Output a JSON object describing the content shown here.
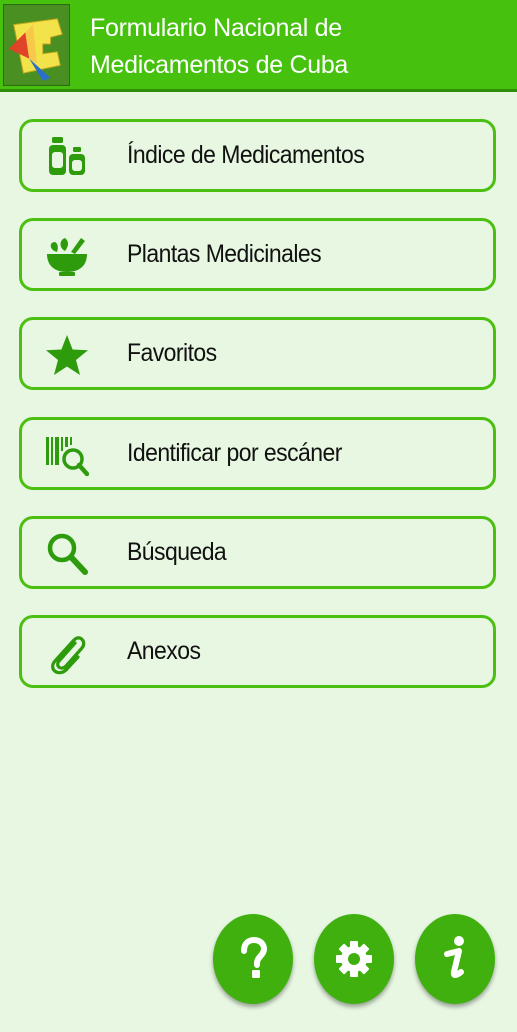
{
  "app": {
    "title_line1": "Formulario Nacional de",
    "title_line2": "Medicamentos de Cuba",
    "logo_icon": "fnm-logo"
  },
  "menu": {
    "items": [
      {
        "label": "Índice de Medicamentos",
        "icon": "medicine-bottles-icon"
      },
      {
        "label": "Plantas Medicinales",
        "icon": "mortar-herbs-icon"
      },
      {
        "label": "Favoritos",
        "icon": "star-icon"
      },
      {
        "label": "Identificar por escáner",
        "icon": "barcode-search-icon"
      },
      {
        "label": "Búsqueda",
        "icon": "search-icon"
      },
      {
        "label": "Anexos",
        "icon": "paperclip-icon"
      }
    ]
  },
  "fabs": {
    "help_icon": "question-icon",
    "settings_icon": "gear-icon",
    "info_icon": "info-icon"
  },
  "colors": {
    "header": "#46c20e",
    "accent": "#4cbf10",
    "icon": "#2e9b0c",
    "background": "#e7f7e2",
    "fab": "#3fb00d"
  }
}
